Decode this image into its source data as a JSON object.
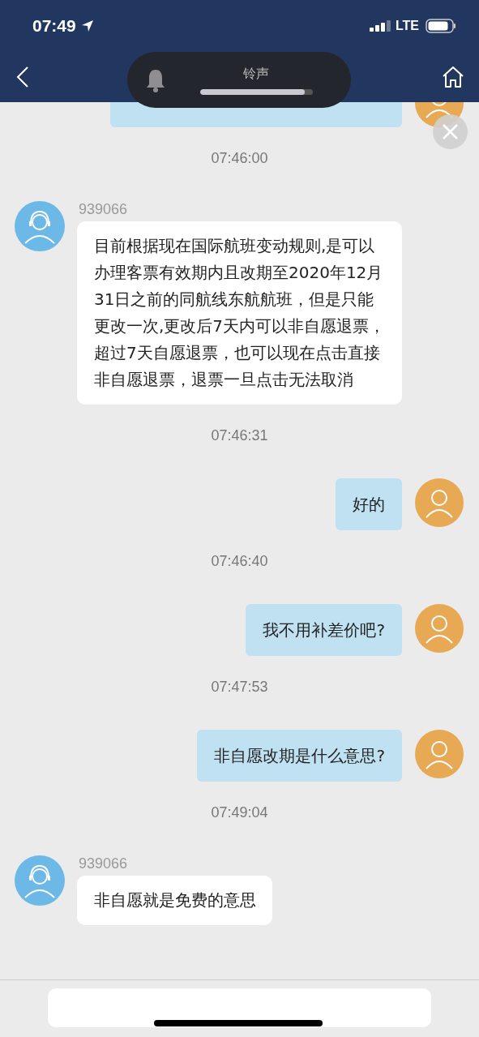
{
  "status_bar": {
    "time": "07:49",
    "network": "LTE"
  },
  "volume_hud": {
    "label": "铃声",
    "level": 0.93
  },
  "messages": [
    {
      "kind": "outgoing_cut"
    },
    {
      "kind": "timestamp",
      "text": "07:46:00"
    },
    {
      "kind": "incoming",
      "sender": "939066",
      "text": "目前根据现在国际航班变动规则,是可以办理客票有效期内且改期至2020年12月31日之前的同航线东航航班，但是只能更改一次,更改后7天内可以非自愿退票，超过7天自愿退票，也可以现在点击直接非自愿退票，退票一旦点击无法取消"
    },
    {
      "kind": "timestamp",
      "text": "07:46:31"
    },
    {
      "kind": "outgoing",
      "text": "好的"
    },
    {
      "kind": "timestamp",
      "text": "07:46:40"
    },
    {
      "kind": "outgoing",
      "text": "我不用补差价吧?"
    },
    {
      "kind": "timestamp",
      "text": "07:47:53"
    },
    {
      "kind": "outgoing",
      "text": "非自愿改期是什么意思?"
    },
    {
      "kind": "timestamp",
      "text": "07:49:04"
    },
    {
      "kind": "incoming",
      "sender": "939066",
      "text": "非自愿就是免费的意思"
    }
  ]
}
